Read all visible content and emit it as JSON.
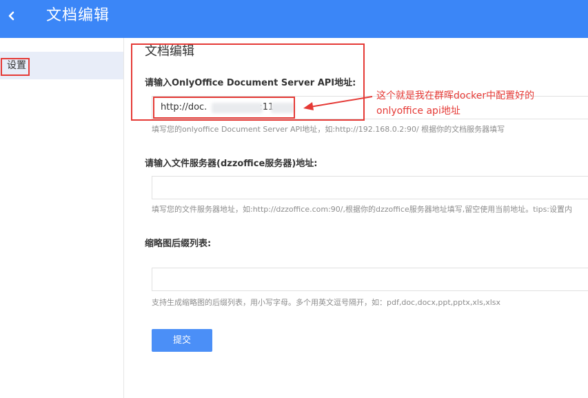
{
  "header": {
    "title": "文档编辑",
    "back_icon": "chevron-left-icon"
  },
  "sidebar": {
    "items": [
      {
        "label": "设置"
      }
    ]
  },
  "main": {
    "section_title": "文档编辑",
    "fields": [
      {
        "label": "请输入OnlyOffice Document Server API地址:",
        "value": "http://doc.",
        "value_suffix": ":11",
        "hint": "填写您的onlyoffice Document Server API地址，如:http://192.168.0.2:90/ 根据你的文档服务器填写"
      },
      {
        "label": "请输入文件服务器(dzzoffice服务器)地址:",
        "value": "",
        "hint": "填写您的文件服务器地址，如:http://dzzoffice.com:90/,根据你的dzzoffice服务器地址填写,留空使用当前地址。tips:设置内"
      },
      {
        "label": "缩略图后缀列表:",
        "value": "",
        "hint": "支持生成缩略图的后缀列表，用小写字母。多个用英文逗号隔开，如：pdf,doc,docx,ppt,pptx,xls,xlsx"
      }
    ],
    "submit_label": "提交"
  },
  "annotation": {
    "lines": [
      "这个就是我在群晖docker中配置好的",
      "onlyoffice api地址"
    ],
    "color": "#e53935"
  },
  "colors": {
    "header_bg": "#3b86f7",
    "sidebar_active_bg": "#e8edf8",
    "button_bg": "#4b8ff7"
  }
}
